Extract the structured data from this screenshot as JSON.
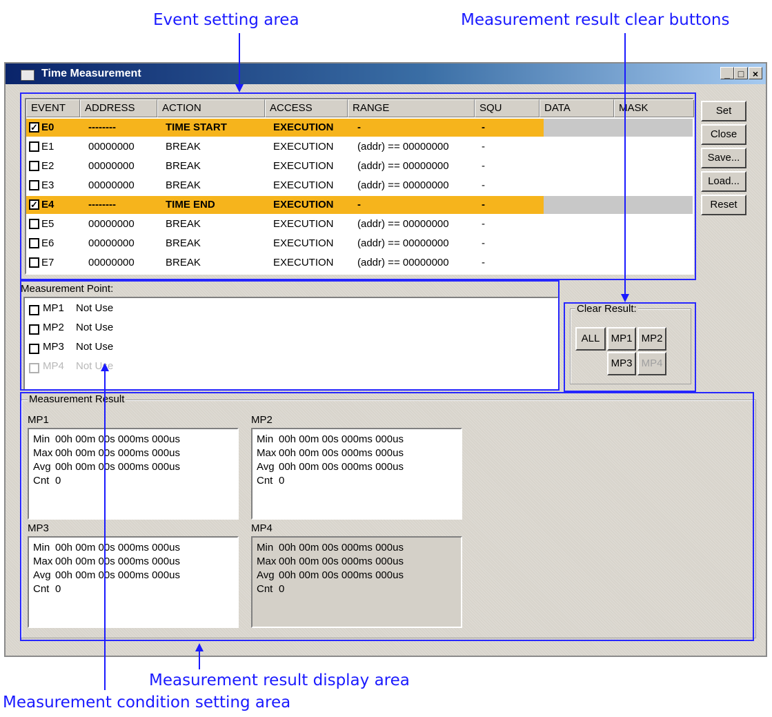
{
  "callouts": {
    "event_setting": "Event setting area",
    "clear_buttons": "Measurement result clear buttons",
    "result_display": "Measurement result display area",
    "condition_setting": "Measurement condition setting area"
  },
  "window": {
    "title": "Time Measurement",
    "controls": {
      "minimize": "_",
      "maximize": "□",
      "close": "×"
    }
  },
  "event_table": {
    "headers": [
      "EVENT",
      "ADDRESS",
      "ACTION",
      "ACCESS",
      "RANGE",
      "SQU",
      "DATA",
      "MASK"
    ],
    "rows": [
      {
        "checked": true,
        "highlight": true,
        "event": "E0",
        "address": "--------",
        "action": "TIME START",
        "access": "EXECUTION",
        "range": "-",
        "squ": "-"
      },
      {
        "checked": false,
        "highlight": false,
        "event": "E1",
        "address": "00000000",
        "action": "BREAK",
        "access": "EXECUTION",
        "range": "(addr) == 00000000",
        "squ": "-"
      },
      {
        "checked": false,
        "highlight": false,
        "event": "E2",
        "address": "00000000",
        "action": "BREAK",
        "access": "EXECUTION",
        "range": "(addr) == 00000000",
        "squ": "-"
      },
      {
        "checked": false,
        "highlight": false,
        "event": "E3",
        "address": "00000000",
        "action": "BREAK",
        "access": "EXECUTION",
        "range": "(addr) == 00000000",
        "squ": "-"
      },
      {
        "checked": true,
        "highlight": true,
        "event": "E4",
        "address": "--------",
        "action": "TIME END",
        "access": "EXECUTION",
        "range": "-",
        "squ": "-"
      },
      {
        "checked": false,
        "highlight": false,
        "event": "E5",
        "address": "00000000",
        "action": "BREAK",
        "access": "EXECUTION",
        "range": "(addr) == 00000000",
        "squ": "-"
      },
      {
        "checked": false,
        "highlight": false,
        "event": "E6",
        "address": "00000000",
        "action": "BREAK",
        "access": "EXECUTION",
        "range": "(addr) == 00000000",
        "squ": "-"
      },
      {
        "checked": false,
        "highlight": false,
        "event": "E7",
        "address": "00000000",
        "action": "BREAK",
        "access": "EXECUTION",
        "range": "(addr) == 00000000",
        "squ": "-"
      }
    ],
    "highlight_color": "#f6b41c"
  },
  "side_buttons": [
    "Set",
    "Close",
    "Save...",
    "Load...",
    "Reset"
  ],
  "measurement_point": {
    "title": "Measurement Point:",
    "items": [
      {
        "name": "MP1",
        "value": "Not Use",
        "enabled": true
      },
      {
        "name": "MP2",
        "value": "Not Use",
        "enabled": true
      },
      {
        "name": "MP3",
        "value": "Not Use",
        "enabled": true
      },
      {
        "name": "MP4",
        "value": "Not Use",
        "enabled": false
      }
    ]
  },
  "clear_result": {
    "title": "Clear Result:",
    "buttons": [
      {
        "label": "ALL",
        "enabled": true
      },
      {
        "label": "MP1",
        "enabled": true
      },
      {
        "label": "MP2",
        "enabled": true
      },
      {
        "label": "MP3",
        "enabled": true
      },
      {
        "label": "MP4",
        "enabled": false
      }
    ]
  },
  "measurement_result": {
    "title": "Measurement Result",
    "panels": [
      {
        "name": "MP1",
        "enabled": true,
        "min": "00h 00m 00s 000ms 000us",
        "max": "00h 00m 00s 000ms 000us",
        "avg": "00h 00m 00s 000ms 000us",
        "cnt": "0"
      },
      {
        "name": "MP2",
        "enabled": true,
        "min": "00h 00m 00s 000ms 000us",
        "max": "00h 00m 00s 000ms 000us",
        "avg": "00h 00m 00s 000ms 000us",
        "cnt": "0"
      },
      {
        "name": "MP3",
        "enabled": true,
        "min": "00h 00m 00s 000ms 000us",
        "max": "00h 00m 00s 000ms 000us",
        "avg": "00h 00m 00s 000ms 000us",
        "cnt": "0"
      },
      {
        "name": "MP4",
        "enabled": false,
        "min": "00h 00m 00s 000ms 000us",
        "max": "00h 00m 00s 000ms 000us",
        "avg": "00h 00m 00s 000ms 000us",
        "cnt": "0"
      }
    ],
    "row_labels": {
      "min": "Min",
      "max": "Max",
      "avg": "Avg",
      "cnt": "Cnt"
    }
  },
  "annotation_color": "#1a1aff"
}
